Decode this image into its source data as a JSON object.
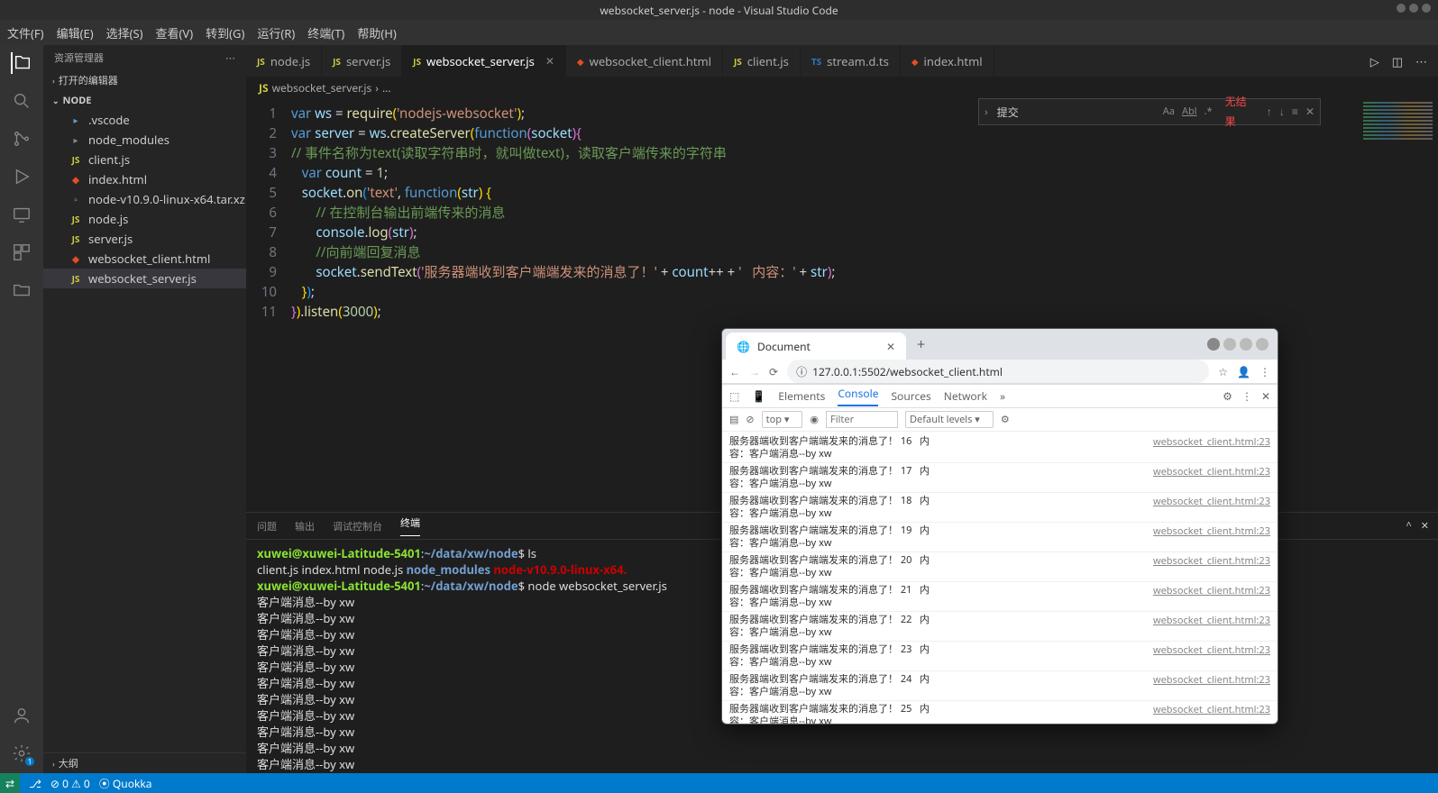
{
  "title": "websocket_server.js - node - Visual Studio Code",
  "menus": [
    "文件(F)",
    "编辑(E)",
    "选择(S)",
    "查看(V)",
    "转到(G)",
    "运行(R)",
    "终端(T)",
    "帮助(H)"
  ],
  "explorer_title": "资源管理器",
  "open_editors_label": "打开的编辑器",
  "project_name": "NODE",
  "outline_label": "大纲",
  "tree": [
    {
      "name": ".vscode",
      "type": "folder",
      "icon": "vscode"
    },
    {
      "name": "node_modules",
      "type": "folder",
      "icon": "folder"
    },
    {
      "name": "client.js",
      "type": "file",
      "icon": "js"
    },
    {
      "name": "index.html",
      "type": "file",
      "icon": "html"
    },
    {
      "name": "node-v10.9.0-linux-x64.tar.xz",
      "type": "file",
      "icon": "archive"
    },
    {
      "name": "node.js",
      "type": "file",
      "icon": "js"
    },
    {
      "name": "server.js",
      "type": "file",
      "icon": "js"
    },
    {
      "name": "websocket_client.html",
      "type": "file",
      "icon": "html"
    },
    {
      "name": "websocket_server.js",
      "type": "file",
      "icon": "js",
      "selected": true
    }
  ],
  "tabs": [
    {
      "label": "node.js",
      "icon": "js",
      "active": false
    },
    {
      "label": "server.js",
      "icon": "js",
      "active": false
    },
    {
      "label": "websocket_server.js",
      "icon": "js",
      "active": true,
      "close": true
    },
    {
      "label": "websocket_client.html",
      "icon": "html",
      "active": false
    },
    {
      "label": "client.js",
      "icon": "js",
      "active": false
    },
    {
      "label": "stream.d.ts",
      "icon": "ts",
      "active": false
    },
    {
      "label": "index.html",
      "icon": "html",
      "active": false
    }
  ],
  "breadcrumb": {
    "file": "websocket_server.js",
    "icon": "js",
    "more": "..."
  },
  "code_lines": [
    "1",
    "2",
    "3",
    "4",
    "5",
    "6",
    "7",
    "8",
    "9",
    "10",
    "11"
  ],
  "find": {
    "value": "提交",
    "result": "无结果"
  },
  "panel_tabs": [
    "问题",
    "输出",
    "调试控制台",
    "终端"
  ],
  "panel_active": "终端",
  "terminal": {
    "prompt_user": "xuwei@xuwei-Latitude-5401",
    "prompt_path": "~/data/xw/node",
    "cmd1": "ls",
    "ls_out": {
      "files": "client.js  index.html  node.js",
      "dir": "node_modules",
      "red": "node-v10.9.0-linux-x64."
    },
    "cmd2": "node websocket_server.js",
    "msg": "客户端消息--by xw",
    "msg_count": 11
  },
  "browser": {
    "tab_title": "Document",
    "url": "127.0.0.1:5502/websocket_client.html",
    "dt_tabs": [
      "Elements",
      "Console",
      "Sources",
      "Network"
    ],
    "dt_active": "Console",
    "context": "top",
    "filter_placeholder": "Filter",
    "levels": "Default levels",
    "msg_prefix": "服务器端收到客户端端发来的消息了！",
    "msg_mid": "内",
    "msg_suffix": "容：客户端消息--by xw",
    "source": "websocket_client.html:23",
    "rows": [
      16,
      17,
      18,
      19,
      20,
      21,
      22,
      23,
      24,
      25
    ]
  },
  "status": {
    "quokka": "Quokka"
  }
}
